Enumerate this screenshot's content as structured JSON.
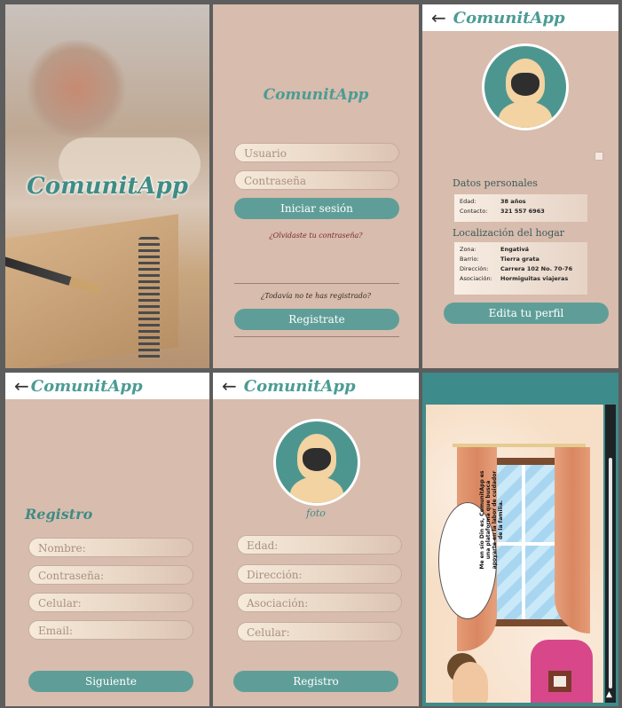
{
  "app": {
    "brand": "ComunitApp"
  },
  "splash": {
    "title": "ComunitApp"
  },
  "login": {
    "title": "ComunitApp",
    "username_placeholder": "Usuario",
    "password_placeholder": "Contraseña",
    "login_button": "Iniciar sesión",
    "forgot_link": "¿Olvidaste tu contraseña?",
    "not_registered": "¿Todavía no te has registrado?",
    "register_button": "Registrate"
  },
  "profile": {
    "brand": "ComunitApp",
    "personal_title": "Datos personales",
    "personal": [
      {
        "k": "Edad:",
        "v": "38 años"
      },
      {
        "k": "Contacto:",
        "v": "321 557 6963"
      }
    ],
    "home_title": "Localización del hogar",
    "home": [
      {
        "k": "Zona:",
        "v": "Engativá"
      },
      {
        "k": "Barrio:",
        "v": "Tierra grata"
      },
      {
        "k": "Dirección:",
        "v": "Carrera 102 No. 70-76"
      },
      {
        "k": "Asociación:",
        "v": "Hormiguitas viajeras"
      }
    ],
    "edit_button": "Edita tu perfil"
  },
  "register1": {
    "brand": "ComunitApp",
    "title": "Registro",
    "fields": [
      "Nombre:",
      "Contraseña:",
      "Celular:",
      "Email:"
    ],
    "next_button": "Siguiente"
  },
  "register2": {
    "brand": "ComunitApp",
    "photo_label": "foto",
    "fields": [
      "Edad:",
      "Dirección:",
      "Asociación:",
      "Celular:"
    ],
    "submit_button": "Registro"
  },
  "intro": {
    "bubble_text": "Me en sío Din es, ComunitApp es una plataforma que busca apoyarte en la labor de cuidador de la familia."
  },
  "colors": {
    "teal": "#5f9e98",
    "panel_bg": "#d8bcad",
    "brand": "#4b9c94"
  },
  "icons": [
    "back-arrow-icon",
    "avatar-icon",
    "scroll-down-icon"
  ]
}
